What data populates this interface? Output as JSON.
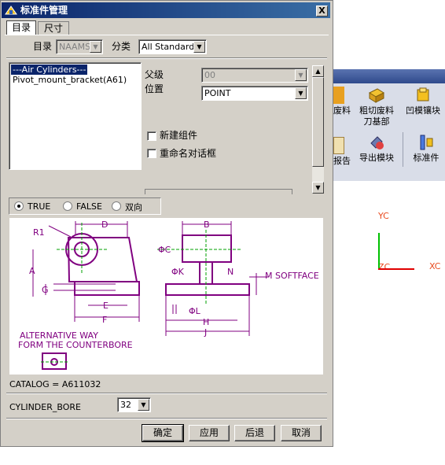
{
  "dialog": {
    "title": "标准件管理",
    "close_label": "X",
    "tabs": [
      {
        "label": "目录"
      },
      {
        "label": "尺寸"
      }
    ],
    "catalog_label": "目录",
    "catalog_value": "NAAMS",
    "classify_label": "分类",
    "classify_value": "All Standards",
    "list_items": [
      "---Air Cylinders---",
      "Pivot_mount_bracket(A61)"
    ],
    "parent_label": "父级",
    "parent_value": "00",
    "position_label": "位置",
    "position_value": "POINT",
    "new_component_label": "新建组件",
    "rename_dialog_label": "重命名对话框",
    "radio_options": [
      "TRUE",
      "FALSE",
      "双向"
    ],
    "selected_radio": "TRUE",
    "catalog_text": "CATALOG = A611032",
    "cylinder_bore_label": "CYLINDER_BORE",
    "cylinder_bore_value": "32",
    "buttons": {
      "ok": "确定",
      "apply": "应用",
      "back": "后退",
      "cancel": "取消"
    }
  },
  "drawing": {
    "labels": {
      "r1": "R1",
      "d": "D",
      "a": "A",
      "g": "G",
      "e": "E",
      "f": "F",
      "b": "B",
      "phi_c": "ΦC",
      "phi_k": "ΦK",
      "n": "N",
      "m_softface": "M SOFTFACE",
      "phi_l": "ΦL",
      "h": "H",
      "j": "J"
    },
    "note_line1": "ALTERNATIVE WAY",
    "note_line2": "FORM THE COUNTERBORE"
  },
  "background": {
    "toolbar": [
      {
        "label": "废料",
        "icon": "scrap-icon"
      },
      {
        "label": "粗切废料刀基部",
        "line1": "粗切废料",
        "line2": "刀基部",
        "icon": "rough-cut-icon"
      },
      {
        "label": "凹模镶块",
        "icon": "die-insert-icon"
      },
      {
        "label": "报告",
        "icon": "report-icon"
      },
      {
        "label": "导出模块",
        "icon": "export-module-icon"
      },
      {
        "label": "标准件",
        "icon": "standard-part-icon"
      }
    ],
    "axes": {
      "yc": "YC",
      "zc": "ZC",
      "xc": "XC"
    },
    "colors": {
      "axis_label": "#e84a1e",
      "y_axis": "#00c000",
      "x_axis": "#e00000",
      "titlebar": "#0a246a",
      "drawing": "#800080"
    }
  }
}
